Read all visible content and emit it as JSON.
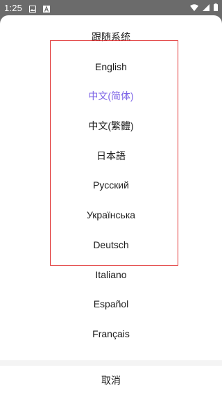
{
  "statusbar": {
    "time": "1:25",
    "icons": [
      "image-icon",
      "a-icon",
      "wifi-icon",
      "signal-icon",
      "battery-icon"
    ]
  },
  "languages": {
    "items": [
      {
        "label": "跟随系统"
      },
      {
        "label": "English"
      },
      {
        "label": "中文(简体)",
        "selected": true
      },
      {
        "label": "中文(繁體)"
      },
      {
        "label": "日本語"
      },
      {
        "label": "Русский"
      },
      {
        "label": "Українська"
      },
      {
        "label": "Deutsch"
      },
      {
        "label": "Italiano"
      },
      {
        "label": "Español"
      },
      {
        "label": "Français"
      }
    ]
  },
  "cancel_label": "取消",
  "colors": {
    "selected": "#7b62e6",
    "highlight_border": "#e03030",
    "status_bar": "#6b6b6b"
  }
}
